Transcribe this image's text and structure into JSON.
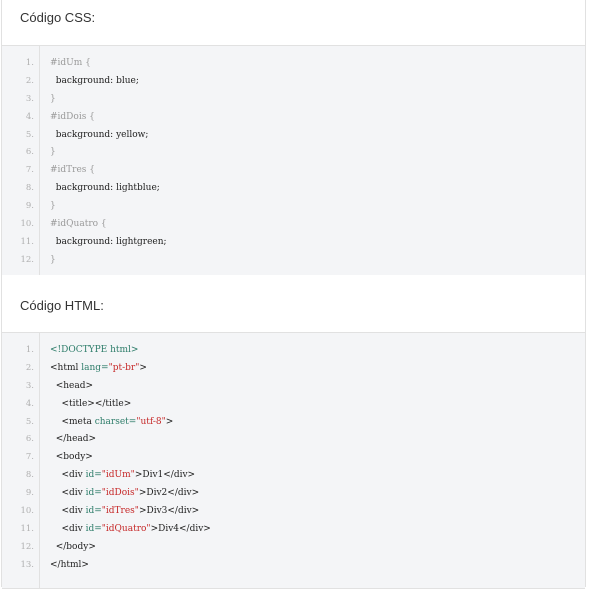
{
  "css_section": {
    "title": "Código CSS:",
    "lines": [
      {
        "n": "1.",
        "tokens": [
          {
            "t": "#idUm {",
            "k": "sel"
          }
        ]
      },
      {
        "n": "2.",
        "tokens": [
          {
            "t": "  background: blue;",
            "k": "prop"
          }
        ]
      },
      {
        "n": "3.",
        "tokens": [
          {
            "t": "}",
            "k": "sel"
          }
        ]
      },
      {
        "n": "4.",
        "tokens": [
          {
            "t": "#idDois {",
            "k": "sel"
          }
        ]
      },
      {
        "n": "5.",
        "tokens": [
          {
            "t": "  background: yellow;",
            "k": "prop"
          }
        ]
      },
      {
        "n": "6.",
        "tokens": [
          {
            "t": "}",
            "k": "sel"
          }
        ]
      },
      {
        "n": "7.",
        "tokens": [
          {
            "t": "#idTres {",
            "k": "sel"
          }
        ]
      },
      {
        "n": "8.",
        "tokens": [
          {
            "t": "  background: lightblue;",
            "k": "prop"
          }
        ]
      },
      {
        "n": "9.",
        "tokens": [
          {
            "t": "}",
            "k": "sel"
          }
        ]
      },
      {
        "n": "10.",
        "tokens": [
          {
            "t": "#idQuatro {",
            "k": "sel"
          }
        ]
      },
      {
        "n": "11.",
        "tokens": [
          {
            "t": "  background: lightgreen;",
            "k": "prop"
          }
        ]
      },
      {
        "n": "12.",
        "tokens": [
          {
            "t": "}",
            "k": "sel"
          }
        ]
      }
    ]
  },
  "html_section": {
    "title": "Código HTML:",
    "lines": [
      {
        "n": "1.",
        "tokens": [
          {
            "t": "<!DOCTYPE html>",
            "k": "doctype"
          }
        ]
      },
      {
        "n": "2.",
        "tokens": [
          {
            "t": "<html ",
            "k": "tag"
          },
          {
            "t": "lang=",
            "k": "attr"
          },
          {
            "t": "\"pt-br\"",
            "k": "str"
          },
          {
            "t": ">",
            "k": "tag"
          }
        ]
      },
      {
        "n": "3.",
        "tokens": [
          {
            "t": "  <head>",
            "k": "tag"
          }
        ]
      },
      {
        "n": "4.",
        "tokens": [
          {
            "t": "    <title></title>",
            "k": "tag"
          }
        ]
      },
      {
        "n": "5.",
        "tokens": [
          {
            "t": "    <meta ",
            "k": "tag"
          },
          {
            "t": "charset=",
            "k": "attr"
          },
          {
            "t": "\"utf-8\"",
            "k": "str"
          },
          {
            "t": ">",
            "k": "tag"
          }
        ]
      },
      {
        "n": "6.",
        "tokens": [
          {
            "t": "  </head>",
            "k": "tag"
          }
        ]
      },
      {
        "n": "7.",
        "tokens": [
          {
            "t": "  <body>",
            "k": "tag"
          }
        ]
      },
      {
        "n": "8.",
        "tokens": [
          {
            "t": "    <div ",
            "k": "tag"
          },
          {
            "t": "id=",
            "k": "attr"
          },
          {
            "t": "\"idUm\"",
            "k": "str"
          },
          {
            "t": ">Div1</div>",
            "k": "tag"
          }
        ]
      },
      {
        "n": "9.",
        "tokens": [
          {
            "t": "    <div ",
            "k": "tag"
          },
          {
            "t": "id=",
            "k": "attr"
          },
          {
            "t": "\"idDois\"",
            "k": "str"
          },
          {
            "t": ">Div2</div>",
            "k": "tag"
          }
        ]
      },
      {
        "n": "10.",
        "tokens": [
          {
            "t": "    <div ",
            "k": "tag"
          },
          {
            "t": "id=",
            "k": "attr"
          },
          {
            "t": "\"idTres\"",
            "k": "str"
          },
          {
            "t": ">Div3</div>",
            "k": "tag"
          }
        ]
      },
      {
        "n": "11.",
        "tokens": [
          {
            "t": "    <div ",
            "k": "tag"
          },
          {
            "t": "id=",
            "k": "attr"
          },
          {
            "t": "\"idQuatro\"",
            "k": "str"
          },
          {
            "t": ">Div4</div>",
            "k": "tag"
          }
        ]
      },
      {
        "n": "12.",
        "tokens": [
          {
            "t": "  </body>",
            "k": "tag"
          }
        ]
      },
      {
        "n": "13.",
        "tokens": [
          {
            "t": "</html>",
            "k": "tag"
          }
        ]
      }
    ]
  },
  "colors": {
    "code_background": "#f4f5f7",
    "border": "#e1e1e1",
    "attribute": "#2e7d6a",
    "string": "#c62828",
    "selector": "#9a9a9a"
  }
}
